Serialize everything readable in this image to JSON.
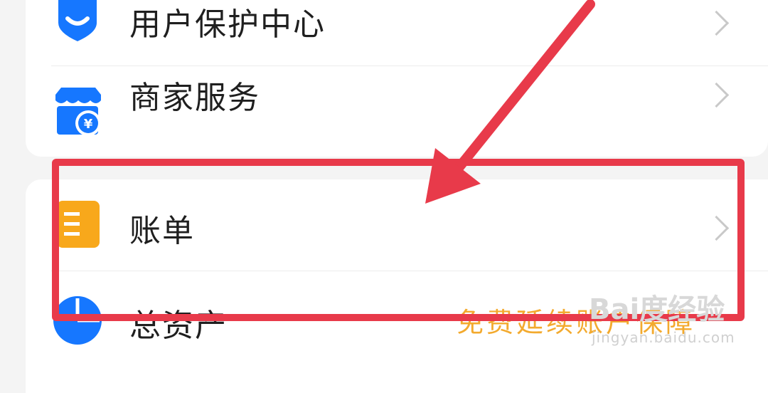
{
  "menu": {
    "items": [
      {
        "label": "用户保护中心",
        "icon": "shield-smile-icon"
      },
      {
        "label": "商家服务",
        "icon": "shop-yuan-icon"
      },
      {
        "label": "账单",
        "icon": "bill-list-icon"
      },
      {
        "label": "总资产",
        "icon": "pie-chart-icon"
      }
    ]
  },
  "promo": {
    "text": "免费延续账户保障"
  },
  "watermark": {
    "logo": "Bai度经验",
    "url": "jingyan.baidu.com"
  },
  "colors": {
    "shield_blue": "#1677ff",
    "bill_yellow": "#f8a81b",
    "annotation_red": "#e83a4a",
    "promo_orange": "#f3a623"
  }
}
